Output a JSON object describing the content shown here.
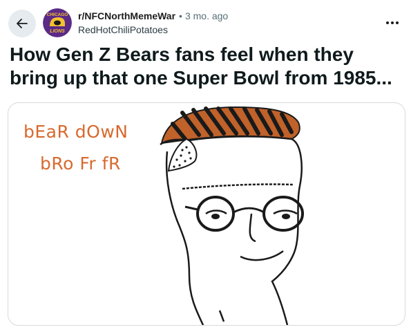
{
  "header": {
    "subreddit": "r/NFCNorthMemeWar",
    "separator": "•",
    "time": "3 mo. ago",
    "user": "RedHotChiliPotatoes",
    "avatar": {
      "top_text": "CHICAGO",
      "bottom_text": "LIONS"
    }
  },
  "post": {
    "title": "How Gen Z Bears fans feel when they bring up that one Super Bowl from 1985...",
    "meme": {
      "line1": "bEaR dOwN",
      "line2": "bRo Fr fR"
    }
  },
  "colors": {
    "back_bg": "#e5ebee",
    "meme_text": "#d8692e",
    "hair": "#c0622a",
    "avatar_bg": "#5b2a86",
    "avatar_helmet": "#f2c230"
  },
  "icons": {
    "back": "arrow-left-icon",
    "more": "ellipsis-icon"
  }
}
